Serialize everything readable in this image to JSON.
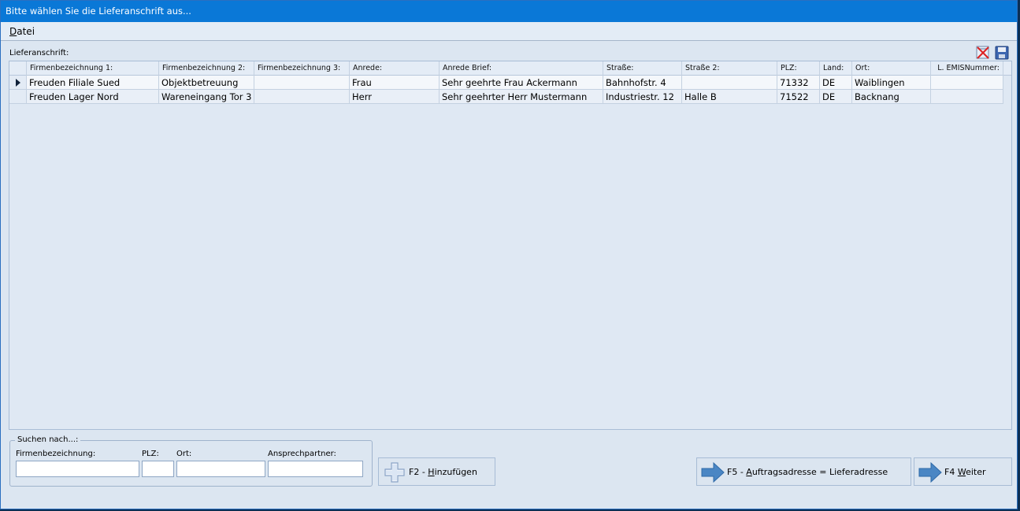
{
  "window": {
    "title": "Bitte wählen Sie die Lieferanschrift aus..."
  },
  "menu": {
    "items": [
      {
        "label_underlined": "D",
        "label_rest": "atei"
      }
    ]
  },
  "section": {
    "label": "Lieferanschrift:"
  },
  "toolbar": {
    "delete_icon": "delete-x-icon",
    "save_icon": "floppy-save-icon"
  },
  "table": {
    "columns": [
      "Firmenbezeichnung 1:",
      "Firmenbezeichnung 2:",
      "Firmenbezeichnung 3:",
      "Anrede:",
      "Anrede Brief:",
      "Straße:",
      "Straße 2:",
      "PLZ:",
      "Land:",
      "Ort:",
      "L. EMISNummer:"
    ],
    "rows": [
      {
        "selected": true,
        "cells": [
          "Freuden Filiale Sued",
          "Objektbetreuung",
          "",
          "Frau",
          "Sehr geehrte Frau Ackermann",
          "Bahnhofstr. 4",
          "",
          "71332",
          "DE",
          "Waiblingen",
          ""
        ]
      },
      {
        "selected": false,
        "cells": [
          "Freuden Lager Nord",
          "Wareneingang Tor 3",
          "",
          "Herr",
          "Sehr geehrter Herr Mustermann",
          "Industriestr. 12",
          "Halle B",
          "71522",
          "DE",
          "Backnang",
          ""
        ]
      }
    ]
  },
  "search": {
    "legend": "Suchen nach...:",
    "fields": {
      "firma": {
        "label": "Firmenbezeichnung:",
        "value": ""
      },
      "plz": {
        "label": "PLZ:",
        "value": ""
      },
      "ort": {
        "label": "Ort:",
        "value": ""
      },
      "ansprech": {
        "label": "Ansprechpartner:",
        "value": ""
      }
    }
  },
  "buttons": {
    "add": {
      "prefix": "F2 - ",
      "underlined": "H",
      "rest": "inzufügen",
      "icon": "plus-icon"
    },
    "assign": {
      "prefix": "F5 - ",
      "underlined": "A",
      "rest": "uftragsadresse = Lieferadresse",
      "icon": "arrow-right-icon"
    },
    "next": {
      "prefix": "F4 ",
      "underlined": "W",
      "rest": "eiter",
      "icon": "arrow-right-icon"
    }
  },
  "colors": {
    "titlebar": "#0a78d7",
    "window_bg": "#dce6f1",
    "arrow_blue": "#4a86c4"
  }
}
